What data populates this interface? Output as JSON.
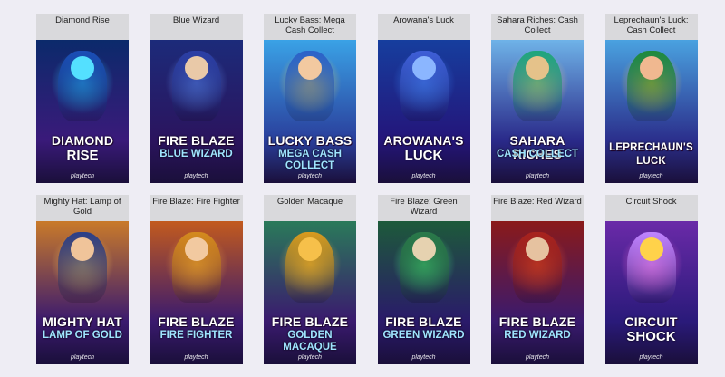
{
  "games": [
    {
      "title": "Diamond Rise",
      "logo_line1": "DIAMOND",
      "logo_line2": "RISE",
      "provider": "playtech",
      "icon": "diamond-icon",
      "colors": {
        "bg_top": "#0b2a6b",
        "bg_bottom": "#3a1a7a",
        "glow": "#29d3ff",
        "figure": "#1b4fb8",
        "head": "#54e0ff"
      }
    },
    {
      "title": "Blue Wizard",
      "logo_line1": "FIRE BLAZE",
      "logo_line2": "BLUE WIZARD",
      "provider": "playtech",
      "icon": "wizard-icon",
      "colors": {
        "bg_top": "#1c2b7a",
        "bg_bottom": "#2b145e",
        "glow": "#6a9cff",
        "figure": "#2c3fa6",
        "head": "#e9c9a8"
      }
    },
    {
      "title": "Lucky Bass: Mega Cash Collect",
      "logo_line1": "LUCKY BASS",
      "logo_line2": "MEGA CASH COLLECT",
      "provider": "playtech",
      "icon": "fisherman-icon",
      "colors": {
        "bg_top": "#3aa2e6",
        "bg_bottom": "#2a3f9c",
        "glow": "#ffd54a",
        "figure": "#2c62c9",
        "head": "#f2c9a0"
      }
    },
    {
      "title": "Arowana's Luck",
      "logo_line1": "AROWANA'S",
      "logo_line2": "LUCK",
      "provider": "playtech",
      "icon": "fish-icon",
      "colors": {
        "bg_top": "#163e9e",
        "bg_bottom": "#24157a",
        "glow": "#3c8cff",
        "figure": "#3f5fd8",
        "head": "#8bb6ff"
      }
    },
    {
      "title": "Sahara Riches: Cash Collect",
      "logo_line1": "SAHARA RICHES",
      "logo_line2": "CASH COLLECT",
      "provider": "playtech",
      "icon": "camel-icon",
      "colors": {
        "bg_top": "#6fb3e8",
        "bg_bottom": "#2a2a8a",
        "glow": "#ffd27a",
        "figure": "#1fa67a",
        "head": "#e5c28a"
      }
    },
    {
      "title": "Leprechaun's Luck: Cash Collect",
      "logo_line1": "LEPRECHAUN'S LUCK",
      "logo_line2": "",
      "provider": "playtech",
      "icon": "leprechaun-icon",
      "colors": {
        "bg_top": "#4aa2e0",
        "bg_bottom": "#2b2f8c",
        "glow": "#ffcf3a",
        "figure": "#1e8a3a",
        "head": "#f0b890"
      }
    },
    {
      "title": "Mighty Hat: Lamp of Gold",
      "logo_line1": "MIGHTY HAT",
      "logo_line2": "LAMP OF GOLD",
      "provider": "playtech",
      "icon": "genie-icon",
      "colors": {
        "bg_top": "#c97a2a",
        "bg_bottom": "#3b1a6e",
        "glow": "#ffcf5a",
        "figure": "#2a3f8a",
        "head": "#f0c49a"
      }
    },
    {
      "title": "Fire Blaze: Fire Fighter",
      "logo_line1": "FIRE BLAZE",
      "logo_line2": "FIRE FIGHTER",
      "provider": "playtech",
      "icon": "firefighter-icon",
      "colors": {
        "bg_top": "#c25a1e",
        "bg_bottom": "#3a1a6e",
        "glow": "#ffb040",
        "figure": "#d48a1e",
        "head": "#f2c9a0"
      }
    },
    {
      "title": "Golden Macaque",
      "logo_line1": "FIRE BLAZE",
      "logo_line2": "GOLDEN MACAQUE",
      "provider": "playtech",
      "icon": "monkey-icon",
      "colors": {
        "bg_top": "#2a7a5a",
        "bg_bottom": "#3a1a6e",
        "glow": "#ffc43a",
        "figure": "#d99a1e",
        "head": "#f6c04a"
      }
    },
    {
      "title": "Fire Blaze: Green Wizard",
      "logo_line1": "FIRE BLAZE",
      "logo_line2": "GREEN WIZARD",
      "provider": "playtech",
      "icon": "wizard-icon",
      "colors": {
        "bg_top": "#1d5a3a",
        "bg_bottom": "#2a1a6a",
        "glow": "#4cff8a",
        "figure": "#2a7a4a",
        "head": "#e6d2b0"
      }
    },
    {
      "title": "Fire Blaze: Red Wizard",
      "logo_line1": "FIRE BLAZE",
      "logo_line2": "RED WIZARD",
      "provider": "playtech",
      "icon": "wizard-icon",
      "colors": {
        "bg_top": "#8a1a1a",
        "bg_bottom": "#3a1a6e",
        "glow": "#ff5a2a",
        "figure": "#a8231e",
        "head": "#e6c2a0"
      }
    },
    {
      "title": "Circuit Shock",
      "logo_line1": "CIRCUIT",
      "logo_line2": "SHOCK",
      "provider": "playtech",
      "icon": "lightning-icon",
      "colors": {
        "bg_top": "#6a2aa8",
        "bg_bottom": "#2a1a7a",
        "glow": "#ff6ad9",
        "figure": "#c084ff",
        "head": "#ffd24a"
      }
    }
  ]
}
